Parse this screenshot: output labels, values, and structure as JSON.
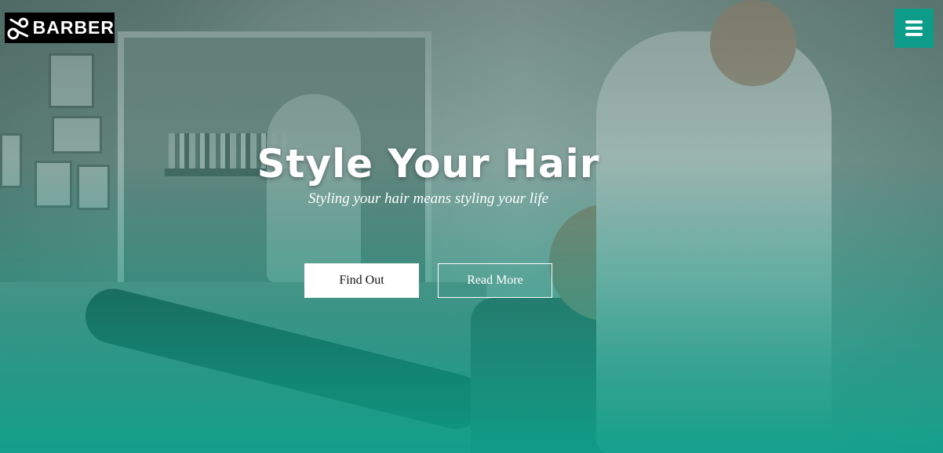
{
  "brand": {
    "name": "BARBER"
  },
  "nav": {
    "menu_icon": "hamburger-menu-icon",
    "menu_color": "#0e9c8a"
  },
  "hero": {
    "title": "Style Your Hair",
    "subtitle": "Styling your hair means styling your life",
    "primary_button": "Find Out",
    "secondary_button": "Read More",
    "overlay_color": "#0aa08a"
  }
}
